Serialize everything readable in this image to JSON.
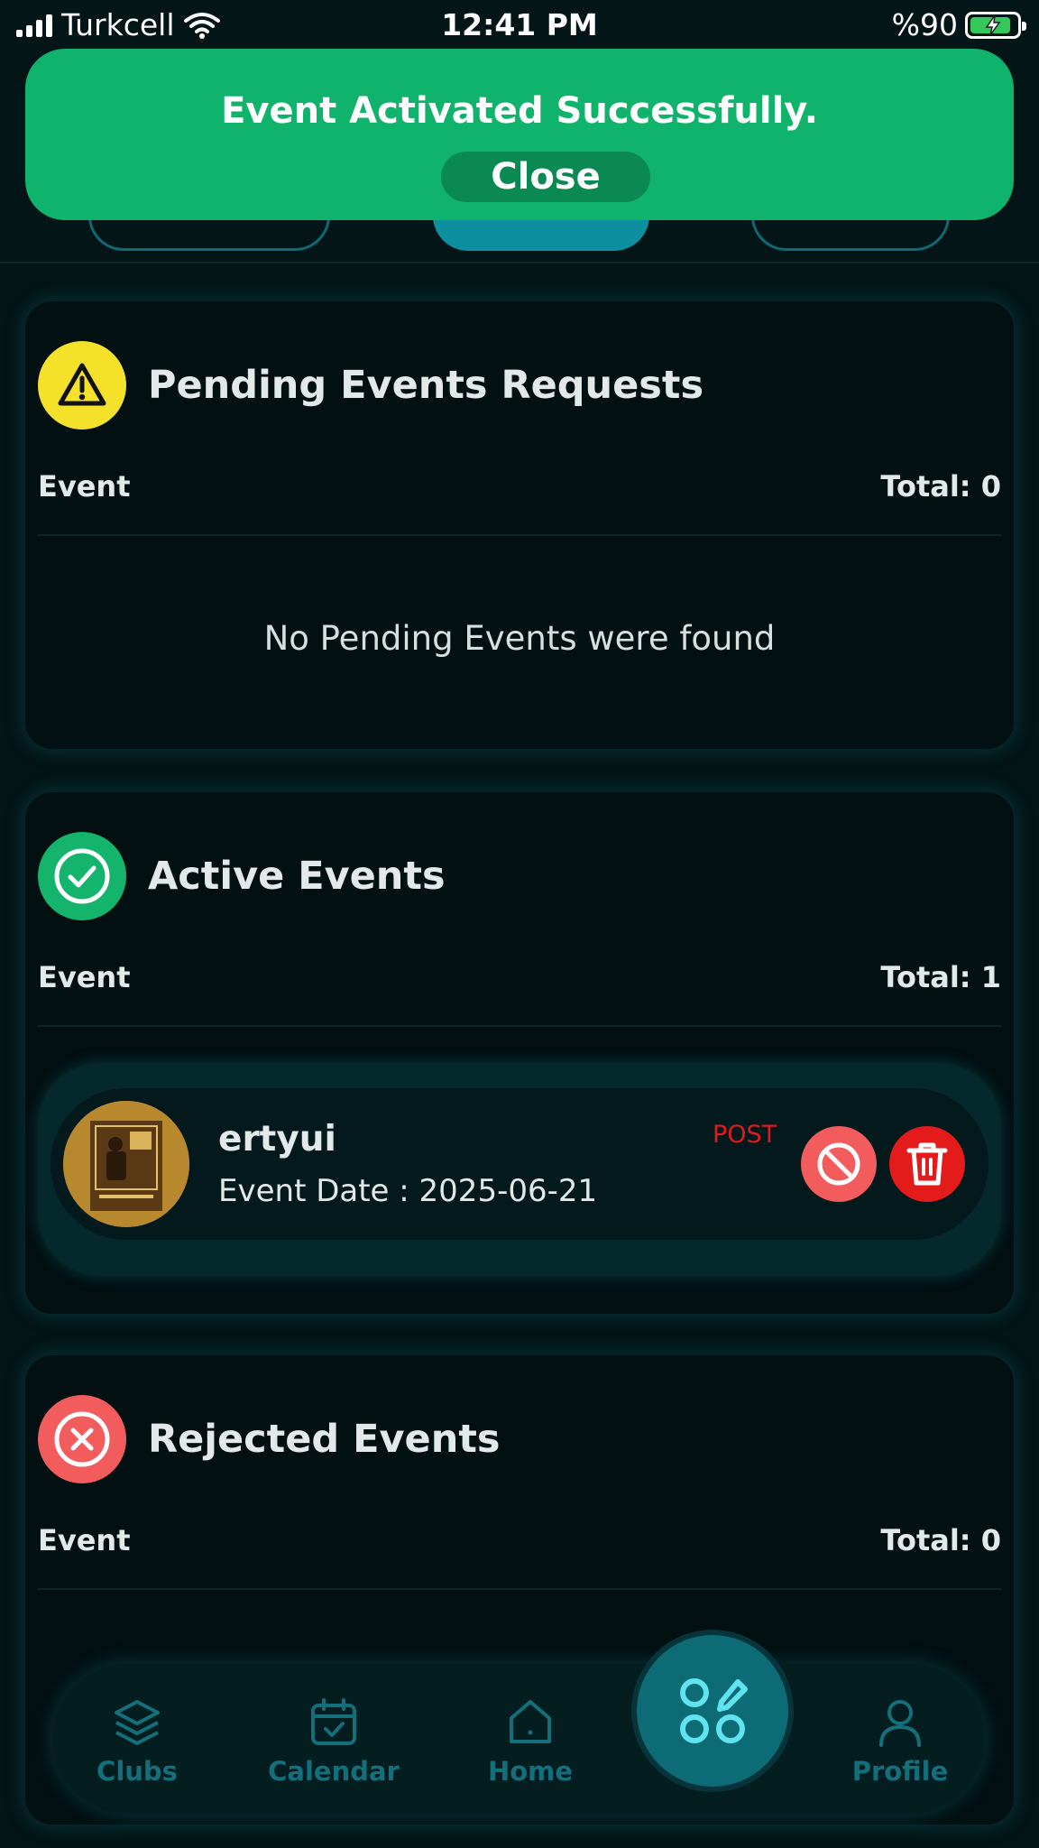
{
  "status_bar": {
    "carrier": "Turkcell",
    "time": "12:41 PM",
    "battery": "%90"
  },
  "toast": {
    "message": "Event Activated Successfully.",
    "close_label": "Close",
    "color": "#10b36b"
  },
  "sections": {
    "pending": {
      "title": "Pending Events Requests",
      "column_label": "Event",
      "total_label": "Total: 0",
      "empty_text": "No Pending Events were found",
      "icon": "warning-icon",
      "icon_color": "#f5e12a"
    },
    "active": {
      "title": "Active Events",
      "column_label": "Event",
      "total_label": "Total: 1",
      "icon": "check-circle-icon",
      "icon_color": "#14b46c",
      "items": [
        {
          "name": "ertyui",
          "date": "Event Date : 2025-06-21",
          "type": "POST"
        }
      ]
    },
    "rejected": {
      "title": "Rejected Events",
      "column_label": "Event",
      "total_label": "Total: 0",
      "icon": "x-circle-icon",
      "icon_color": "#f25c5c"
    }
  },
  "bottom_nav": {
    "items": [
      {
        "label": "Clubs",
        "icon": "layers-icon"
      },
      {
        "label": "Calendar",
        "icon": "calendar-check-icon"
      },
      {
        "label": "Home",
        "icon": "home-icon"
      },
      {
        "label": "Profile",
        "icon": "user-icon"
      }
    ],
    "fab_icon": "grid-edit-icon"
  }
}
